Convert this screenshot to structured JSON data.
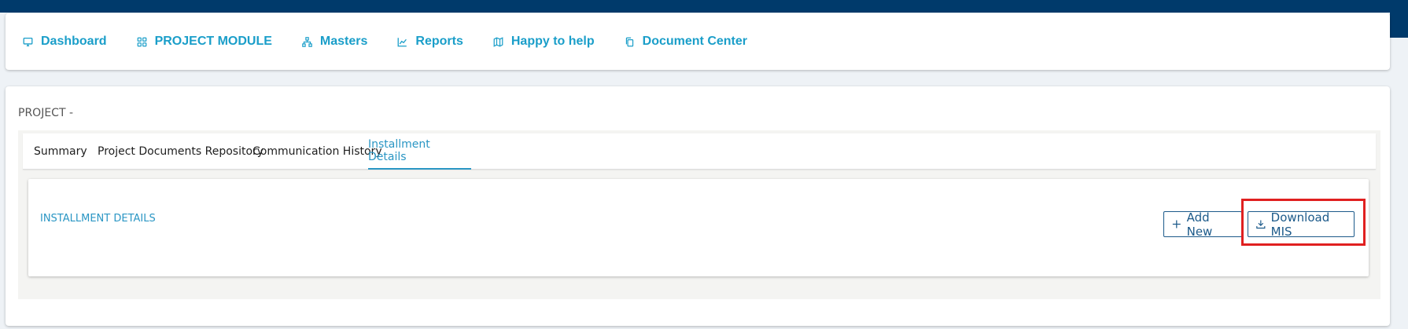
{
  "nav": {
    "items": [
      {
        "label": "Dashboard",
        "icon": "monitor-icon"
      },
      {
        "label": "PROJECT MODULE",
        "icon": "grid-icon"
      },
      {
        "label": "Masters",
        "icon": "sitemap-icon"
      },
      {
        "label": "Reports",
        "icon": "chart-line-icon"
      },
      {
        "label": "Happy to help",
        "icon": "map-icon"
      },
      {
        "label": "Document Center",
        "icon": "copy-icon"
      }
    ]
  },
  "project": {
    "title": "PROJECT -"
  },
  "tabs": [
    {
      "label": "Summary",
      "active": false
    },
    {
      "label": "Project Documents Repository",
      "active": false
    },
    {
      "label": "Communication History",
      "active": false
    },
    {
      "label": "Installment Details",
      "active": true
    }
  ],
  "installment": {
    "section_title": "INSTALLMENT DETAILS",
    "add_new_label": "Add New",
    "download_label": "Download MIS"
  },
  "colors": {
    "brand_dark": "#003a6b",
    "nav_link": "#1a9ec9",
    "accent": "#2a96c4",
    "button_border": "#1c5a8a",
    "highlight": "#e02020"
  }
}
